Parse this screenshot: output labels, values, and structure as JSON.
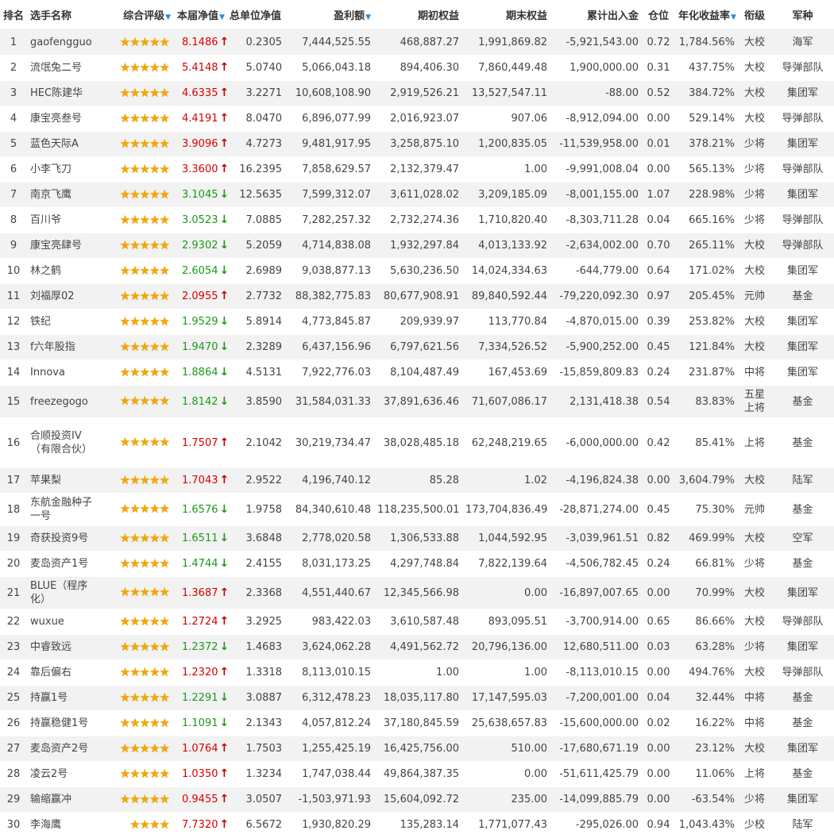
{
  "headers": [
    "排名",
    "选手名称",
    "综合评级",
    "本届净值",
    "总单位净值",
    "盈利额",
    "期初权益",
    "期末权益",
    "累计出入金",
    "仓位",
    "年化收益率",
    "衔级",
    "军种"
  ],
  "sortable": [
    false,
    false,
    true,
    true,
    false,
    true,
    false,
    false,
    false,
    false,
    true,
    false,
    false
  ],
  "colors": {
    "up": "#d80000",
    "down": "#1a9a1a",
    "star": "#f5a700",
    "sort_icon": "#2a8bd6",
    "stripe": "#f2f2f2"
  },
  "icons": {
    "star": "star-icon",
    "up": "arrow-up-icon",
    "down": "arrow-down-icon",
    "sort": "sort-down-icon"
  },
  "rows": [
    {
      "rank": "1",
      "name": "gaofengguo",
      "stars": 5,
      "nav": "8.1486",
      "dir": "up",
      "unit_nav": "0.2305",
      "profit": "7,444,525.55",
      "start_equity": "468,887.27",
      "end_equity": "1,991,869.82",
      "net_flow": "-5,921,543.00",
      "position": "0.72",
      "annual": "1,784.56%",
      "rankname": "大校",
      "branch": "海军"
    },
    {
      "rank": "2",
      "name": "流氓兔二号",
      "stars": 5,
      "nav": "5.4148",
      "dir": "up",
      "unit_nav": "5.0740",
      "profit": "5,066,043.18",
      "start_equity": "894,406.30",
      "end_equity": "7,860,449.48",
      "net_flow": "1,900,000.00",
      "position": "0.31",
      "annual": "437.75%",
      "rankname": "大校",
      "branch": "导弹部队"
    },
    {
      "rank": "3",
      "name": "HEC陈建华",
      "stars": 5,
      "nav": "4.6335",
      "dir": "up",
      "unit_nav": "3.2271",
      "profit": "10,608,108.90",
      "start_equity": "2,919,526.21",
      "end_equity": "13,527,547.11",
      "net_flow": "-88.00",
      "position": "0.52",
      "annual": "384.72%",
      "rankname": "大校",
      "branch": "集团军"
    },
    {
      "rank": "4",
      "name": "康宝亮叁号",
      "stars": 5,
      "nav": "4.4191",
      "dir": "up",
      "unit_nav": "8.0470",
      "profit": "6,896,077.99",
      "start_equity": "2,016,923.07",
      "end_equity": "907.06",
      "net_flow": "-8,912,094.00",
      "position": "0.00",
      "annual": "529.14%",
      "rankname": "大校",
      "branch": "导弹部队"
    },
    {
      "rank": "5",
      "name": "蓝色天际A",
      "stars": 5,
      "nav": "3.9096",
      "dir": "up",
      "unit_nav": "4.7273",
      "profit": "9,481,917.95",
      "start_equity": "3,258,875.10",
      "end_equity": "1,200,835.05",
      "net_flow": "-11,539,958.00",
      "position": "0.01",
      "annual": "378.21%",
      "rankname": "少将",
      "branch": "集团军"
    },
    {
      "rank": "6",
      "name": "小李飞刀",
      "stars": 5,
      "nav": "3.3600",
      "dir": "up",
      "unit_nav": "16.2395",
      "profit": "7,858,629.57",
      "start_equity": "2,132,379.47",
      "end_equity": "1.00",
      "net_flow": "-9,991,008.04",
      "position": "0.00",
      "annual": "565.13%",
      "rankname": "少将",
      "branch": "导弹部队"
    },
    {
      "rank": "7",
      "name": "南京飞鹰",
      "stars": 5,
      "nav": "3.1045",
      "dir": "down",
      "unit_nav": "12.5635",
      "profit": "7,599,312.07",
      "start_equity": "3,611,028.02",
      "end_equity": "3,209,185.09",
      "net_flow": "-8,001,155.00",
      "position": "1.07",
      "annual": "228.98%",
      "rankname": "少将",
      "branch": "集团军"
    },
    {
      "rank": "8",
      "name": "百川爷",
      "stars": 5,
      "nav": "3.0523",
      "dir": "down",
      "unit_nav": "7.0885",
      "profit": "7,282,257.32",
      "start_equity": "2,732,274.36",
      "end_equity": "1,710,820.40",
      "net_flow": "-8,303,711.28",
      "position": "0.04",
      "annual": "665.16%",
      "rankname": "少将",
      "branch": "导弹部队"
    },
    {
      "rank": "9",
      "name": "康宝亮肆号",
      "stars": 5,
      "nav": "2.9302",
      "dir": "down",
      "unit_nav": "5.2059",
      "profit": "4,714,838.08",
      "start_equity": "1,932,297.84",
      "end_equity": "4,013,133.92",
      "net_flow": "-2,634,002.00",
      "position": "0.70",
      "annual": "265.11%",
      "rankname": "大校",
      "branch": "导弹部队"
    },
    {
      "rank": "10",
      "name": "林之鹤",
      "stars": 5,
      "nav": "2.6054",
      "dir": "down",
      "unit_nav": "2.6989",
      "profit": "9,038,877.13",
      "start_equity": "5,630,236.50",
      "end_equity": "14,024,334.63",
      "net_flow": "-644,779.00",
      "position": "0.64",
      "annual": "171.02%",
      "rankname": "大校",
      "branch": "集团军"
    },
    {
      "rank": "11",
      "name": "刘福厚02",
      "stars": 5,
      "nav": "2.0955",
      "dir": "up",
      "unit_nav": "2.7732",
      "profit": "88,382,775.83",
      "start_equity": "80,677,908.91",
      "end_equity": "89,840,592.44",
      "net_flow": "-79,220,092.30",
      "position": "0.97",
      "annual": "205.45%",
      "rankname": "元帅",
      "branch": "基金"
    },
    {
      "rank": "12",
      "name": "铁纪",
      "stars": 5,
      "nav": "1.9529",
      "dir": "down",
      "unit_nav": "5.8914",
      "profit": "4,773,845.87",
      "start_equity": "209,939.97",
      "end_equity": "113,770.84",
      "net_flow": "-4,870,015.00",
      "position": "0.39",
      "annual": "253.82%",
      "rankname": "大校",
      "branch": "集团军"
    },
    {
      "rank": "13",
      "name": "f六年股指",
      "stars": 5,
      "nav": "1.9470",
      "dir": "down",
      "unit_nav": "2.3289",
      "profit": "6,437,156.96",
      "start_equity": "6,797,621.56",
      "end_equity": "7,334,526.52",
      "net_flow": "-5,900,252.00",
      "position": "0.45",
      "annual": "121.84%",
      "rankname": "大校",
      "branch": "集团军"
    },
    {
      "rank": "14",
      "name": "Innova",
      "stars": 5,
      "nav": "1.8864",
      "dir": "down",
      "unit_nav": "4.5131",
      "profit": "7,922,776.03",
      "start_equity": "8,104,487.49",
      "end_equity": "167,453.69",
      "net_flow": "-15,859,809.83",
      "position": "0.24",
      "annual": "231.87%",
      "rankname": "中将",
      "branch": "集团军"
    },
    {
      "rank": "15",
      "name": "freezegogo",
      "stars": 5,
      "nav": "1.8142",
      "dir": "down",
      "unit_nav": "3.8590",
      "profit": "31,584,031.33",
      "start_equity": "37,891,636.46",
      "end_equity": "71,607,086.17",
      "net_flow": "2,131,418.38",
      "position": "0.54",
      "annual": "83.83%",
      "rankname": "五星上将",
      "branch": "基金",
      "cls": "mid"
    },
    {
      "rank": "16",
      "name": "合顺投资IV（有限合伙）",
      "stars": 5,
      "nav": "1.7507",
      "dir": "up",
      "unit_nav": "2.1042",
      "profit": "30,219,734.47",
      "start_equity": "38,028,485.18",
      "end_equity": "62,248,219.65",
      "net_flow": "-6,000,000.00",
      "position": "0.42",
      "annual": "85.41%",
      "rankname": "上将",
      "branch": "基金",
      "cls": "tall"
    },
    {
      "rank": "17",
      "name": "苹果梨",
      "stars": 5,
      "nav": "1.7043",
      "dir": "up",
      "unit_nav": "2.9522",
      "profit": "4,196,740.12",
      "start_equity": "85.28",
      "end_equity": "1.02",
      "net_flow": "-4,196,824.38",
      "position": "0.00",
      "annual": "3,604.79%",
      "rankname": "大校",
      "branch": "陆军"
    },
    {
      "rank": "18",
      "name": "东航金融种子一号",
      "stars": 5,
      "nav": "1.6576",
      "dir": "down",
      "unit_nav": "1.9758",
      "profit": "84,340,610.48",
      "start_equity": "118,235,500.01",
      "end_equity": "173,704,836.49",
      "net_flow": "-28,871,274.00",
      "position": "0.45",
      "annual": "75.30%",
      "rankname": "元帅",
      "branch": "基金",
      "cls": "mid"
    },
    {
      "rank": "19",
      "name": "奇获投资9号",
      "stars": 5,
      "nav": "1.6511",
      "dir": "down",
      "unit_nav": "3.6848",
      "profit": "2,778,020.58",
      "start_equity": "1,306,533.88",
      "end_equity": "1,044,592.95",
      "net_flow": "-3,039,961.51",
      "position": "0.82",
      "annual": "469.99%",
      "rankname": "大校",
      "branch": "空军"
    },
    {
      "rank": "20",
      "name": "麦岛资产1号",
      "stars": 5,
      "nav": "1.4744",
      "dir": "down",
      "unit_nav": "2.4155",
      "profit": "8,031,173.25",
      "start_equity": "4,297,748.84",
      "end_equity": "7,822,139.64",
      "net_flow": "-4,506,782.45",
      "position": "0.24",
      "annual": "66.81%",
      "rankname": "少将",
      "branch": "基金"
    },
    {
      "rank": "21",
      "name": "BLUE（程序化）",
      "stars": 5,
      "nav": "1.3687",
      "dir": "up",
      "unit_nav": "2.3368",
      "profit": "4,551,440.67",
      "start_equity": "12,345,566.98",
      "end_equity": "0.00",
      "net_flow": "-16,897,007.65",
      "position": "0.00",
      "annual": "70.99%",
      "rankname": "大校",
      "branch": "集团军",
      "cls": "mid"
    },
    {
      "rank": "22",
      "name": "wuxue",
      "stars": 5,
      "nav": "1.2724",
      "dir": "up",
      "unit_nav": "3.2925",
      "profit": "983,422.03",
      "start_equity": "3,610,587.48",
      "end_equity": "893,095.51",
      "net_flow": "-3,700,914.00",
      "position": "0.65",
      "annual": "86.66%",
      "rankname": "大校",
      "branch": "导弹部队"
    },
    {
      "rank": "23",
      "name": "中睿致远",
      "stars": 5,
      "nav": "1.2372",
      "dir": "down",
      "unit_nav": "1.4683",
      "profit": "3,624,062.28",
      "start_equity": "4,491,562.72",
      "end_equity": "20,796,136.00",
      "net_flow": "12,680,511.00",
      "position": "0.03",
      "annual": "63.28%",
      "rankname": "少将",
      "branch": "集团军"
    },
    {
      "rank": "24",
      "name": "靠后偏右",
      "stars": 5,
      "nav": "1.2320",
      "dir": "up",
      "unit_nav": "1.3318",
      "profit": "8,113,010.15",
      "start_equity": "1.00",
      "end_equity": "1.00",
      "net_flow": "-8,113,010.15",
      "position": "0.00",
      "annual": "494.76%",
      "rankname": "大校",
      "branch": "导弹部队"
    },
    {
      "rank": "25",
      "name": "持赢1号",
      "stars": 5,
      "nav": "1.2291",
      "dir": "down",
      "unit_nav": "3.0887",
      "profit": "6,312,478.23",
      "start_equity": "18,035,117.80",
      "end_equity": "17,147,595.03",
      "net_flow": "-7,200,001.00",
      "position": "0.04",
      "annual": "32.44%",
      "rankname": "中将",
      "branch": "基金"
    },
    {
      "rank": "26",
      "name": "持赢稳健1号",
      "stars": 5,
      "nav": "1.1091",
      "dir": "down",
      "unit_nav": "2.1343",
      "profit": "4,057,812.24",
      "start_equity": "37,180,845.59",
      "end_equity": "25,638,657.83",
      "net_flow": "-15,600,000.00",
      "position": "0.02",
      "annual": "16.22%",
      "rankname": "中将",
      "branch": "基金"
    },
    {
      "rank": "27",
      "name": "麦岛资产2号",
      "stars": 5,
      "nav": "1.0764",
      "dir": "up",
      "unit_nav": "1.7503",
      "profit": "1,255,425.19",
      "start_equity": "16,425,756.00",
      "end_equity": "510.00",
      "net_flow": "-17,680,671.19",
      "position": "0.00",
      "annual": "23.12%",
      "rankname": "大校",
      "branch": "集团军"
    },
    {
      "rank": "28",
      "name": "凌云2号",
      "stars": 5,
      "nav": "1.0350",
      "dir": "up",
      "unit_nav": "1.3234",
      "profit": "1,747,038.44",
      "start_equity": "49,864,387.35",
      "end_equity": "0.00",
      "net_flow": "-51,611,425.79",
      "position": "0.00",
      "annual": "11.06%",
      "rankname": "上将",
      "branch": "基金"
    },
    {
      "rank": "29",
      "name": "输缩赢冲",
      "stars": 5,
      "nav": "0.9455",
      "dir": "up",
      "unit_nav": "3.0507",
      "profit": "-1,503,971.93",
      "start_equity": "15,604,092.72",
      "end_equity": "235.00",
      "net_flow": "-14,099,885.79",
      "position": "0.00",
      "annual": "-63.54%",
      "rankname": "少将",
      "branch": "集团军"
    },
    {
      "rank": "30",
      "name": "李海鹰",
      "stars": 4,
      "nav": "7.7320",
      "dir": "up",
      "unit_nav": "6.5672",
      "profit": "1,930,820.29",
      "start_equity": "135,283.14",
      "end_equity": "1,771,077.43",
      "net_flow": "-295,026.00",
      "position": "0.94",
      "annual": "1,043.43%",
      "rankname": "少校",
      "branch": "陆军"
    }
  ]
}
